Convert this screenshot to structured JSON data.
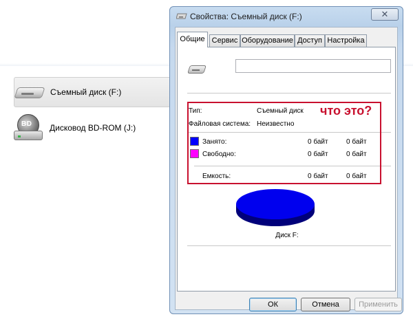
{
  "explorer": {
    "drives": [
      {
        "label": "Съемный диск (F:)",
        "icon": "usb-drive-icon",
        "selected": true
      },
      {
        "label": "Дисковод BD-ROM (J:)",
        "icon": "bd-rom-drive-icon",
        "icon_text": "BD",
        "selected": false
      }
    ]
  },
  "dialog": {
    "title": "Свойства: Съемный диск (F:)",
    "close_glyph": "✕",
    "tabs": [
      {
        "label": "Общие",
        "active": true
      },
      {
        "label": "Сервис",
        "active": false
      },
      {
        "label": "Оборудование",
        "active": false
      },
      {
        "label": "Доступ",
        "active": false
      },
      {
        "label": "Настройка",
        "active": false
      }
    ],
    "general": {
      "volume_name_value": "",
      "type_label": "Тип:",
      "type_value": "Съемный диск",
      "fs_label": "Файловая система:",
      "fs_value": "Неизвестно",
      "used_label": "Занято:",
      "used_bytes": "0 байт",
      "used_size": "0 байт",
      "free_label": "Свободно:",
      "free_bytes": "0 байт",
      "free_size": "0 байт",
      "capacity_label": "Емкость:",
      "capacity_bytes": "0 байт",
      "capacity_size": "0 байт",
      "disk_label": "Диск F:",
      "used_color": "#0000ff",
      "free_color": "#ff00ff"
    },
    "annotation_text": "что это?",
    "annotation_color": "#c8102e",
    "buttons": {
      "ok": "ОК",
      "cancel": "Отмена",
      "apply": "Применить"
    }
  }
}
